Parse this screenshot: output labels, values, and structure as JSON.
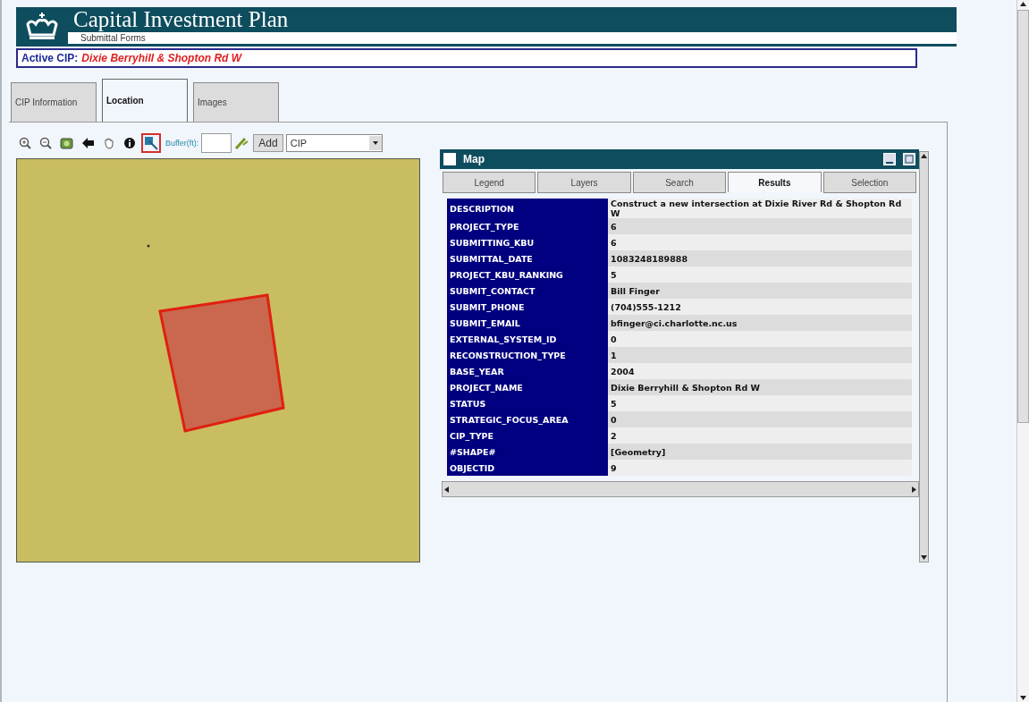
{
  "header": {
    "title": "Capital Investment Plan",
    "subtitle": "Submittal Forms"
  },
  "active_cip": {
    "label": "Active CIP:",
    "value": "Dixie Berryhill & Shopton Rd W"
  },
  "tabs": [
    {
      "label": "CIP Information",
      "selected": false
    },
    {
      "label": "Location",
      "selected": true
    },
    {
      "label": "Images",
      "selected": false
    }
  ],
  "toolbar": {
    "tools": [
      {
        "kind": "zoom-in",
        "selected": false
      },
      {
        "kind": "zoom-out",
        "selected": false
      },
      {
        "kind": "full-extent",
        "selected": false
      },
      {
        "kind": "back",
        "selected": false
      },
      {
        "kind": "pan",
        "selected": false
      },
      {
        "kind": "info",
        "selected": false
      },
      {
        "kind": "select",
        "selected": true
      }
    ],
    "buffer_label": "Buffer(ft):",
    "add_button": "Add",
    "layer_select": "CIP"
  },
  "map_window": {
    "title": "Map",
    "tabs": [
      {
        "label": "Legend",
        "selected": false
      },
      {
        "label": "Layers",
        "selected": false
      },
      {
        "label": "Search",
        "selected": false
      },
      {
        "label": "Results",
        "selected": true
      },
      {
        "label": "Selection",
        "selected": false
      }
    ],
    "rows": [
      {
        "field": "DESCRIPTION",
        "value": "Construct a new intersection at Dixie River Rd & Shopton Rd W"
      },
      {
        "field": "PROJECT_TYPE",
        "value": "6"
      },
      {
        "field": "SUBMITTING_KBU",
        "value": "6"
      },
      {
        "field": "SUBMITTAL_DATE",
        "value": "1083248189888"
      },
      {
        "field": "PROJECT_KBU_RANKING",
        "value": "5"
      },
      {
        "field": "SUBMIT_CONTACT",
        "value": "Bill Finger"
      },
      {
        "field": "SUBMIT_PHONE",
        "value": "(704)555-1212"
      },
      {
        "field": "SUBMIT_EMAIL",
        "value": "bfinger@ci.charlotte.nc.us"
      },
      {
        "field": "EXTERNAL_SYSTEM_ID",
        "value": "0"
      },
      {
        "field": "RECONSTRUCTION_TYPE",
        "value": "1"
      },
      {
        "field": "BASE_YEAR",
        "value": "2004"
      },
      {
        "field": "PROJECT_NAME",
        "value": "Dixie Berryhill & Shopton Rd W"
      },
      {
        "field": "STATUS",
        "value": "5"
      },
      {
        "field": "STRATEGIC_FOCUS_AREA",
        "value": "0"
      },
      {
        "field": "CIP_TYPE",
        "value": "2"
      },
      {
        "field": "#SHAPE#",
        "value": "[Geometry]"
      },
      {
        "field": "OBJECTID",
        "value": "9"
      }
    ]
  }
}
